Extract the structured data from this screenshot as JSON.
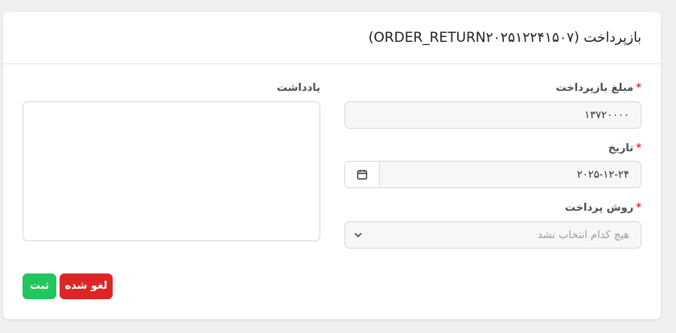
{
  "header": {
    "title": "بازپرداخت (ORDER_RETURN۲۰۲۵۱۲۲۴۱۵۰۷)"
  },
  "form": {
    "amount": {
      "label": "مبلغ بازپرداخت",
      "required_mark": "*",
      "value": "۱۳۷۲۰۰۰۰"
    },
    "date": {
      "label": "تاریخ",
      "required_mark": "*",
      "value": "۲۰۲۵-۱۲-۲۴",
      "icon": "calendar-icon"
    },
    "payment_method": {
      "label": "روش پرداخت",
      "required_mark": "*",
      "placeholder": "هیچ کدام انتخاب نشد",
      "icon": "chevron-down-icon"
    },
    "note": {
      "label": "یادداشت",
      "value": ""
    }
  },
  "actions": {
    "submit_label": "ثبت",
    "cancel_label": "لغو شده"
  },
  "colors": {
    "submit": "#22c55e",
    "cancel": "#dc2626",
    "required": "#e53935"
  }
}
